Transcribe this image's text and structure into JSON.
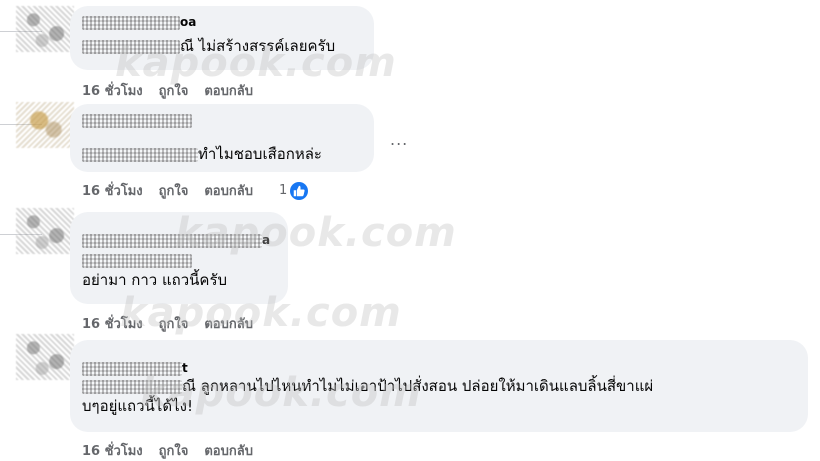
{
  "comments": [
    {
      "author_suffix": "oa",
      "text_suffix": "ณี ไม่สร้างสรรค์เลยครับ",
      "time": "16 ชั่วโมง",
      "like": "ถูกใจ",
      "reply": "ตอบกลับ"
    },
    {
      "text_suffix": "ทำไมชอบเสือกหล่ะ",
      "more": "...",
      "time": "16 ชั่วโมง",
      "like": "ถูกใจ",
      "reply": "ตอบกลับ",
      "like_count": "1"
    },
    {
      "author_suffix": "a",
      "text_line2": "อย่ามา กาว แถวนี้ครับ",
      "time": "16 ชั่วโมง",
      "like": "ถูกใจ",
      "reply": "ตอบกลับ"
    },
    {
      "author_suffix": "t",
      "text_line1": "ณี ลูกหลานไปไหนทำไมไม่เอาป้าไปสั่งสอน ปล่อยให้มาเดินแลบลิ้นสี่ขาแผ่",
      "text_line2": "บๆอยู่แถวนี้ได้ไง!",
      "time": "16 ชั่วโมง",
      "like": "ถูกใจ",
      "reply": "ตอบกลับ"
    }
  ],
  "watermark": "kapook.com",
  "colors": {
    "bubble": "#f0f2f5",
    "meta": "#65676b",
    "like_blue": "#1877f2"
  }
}
